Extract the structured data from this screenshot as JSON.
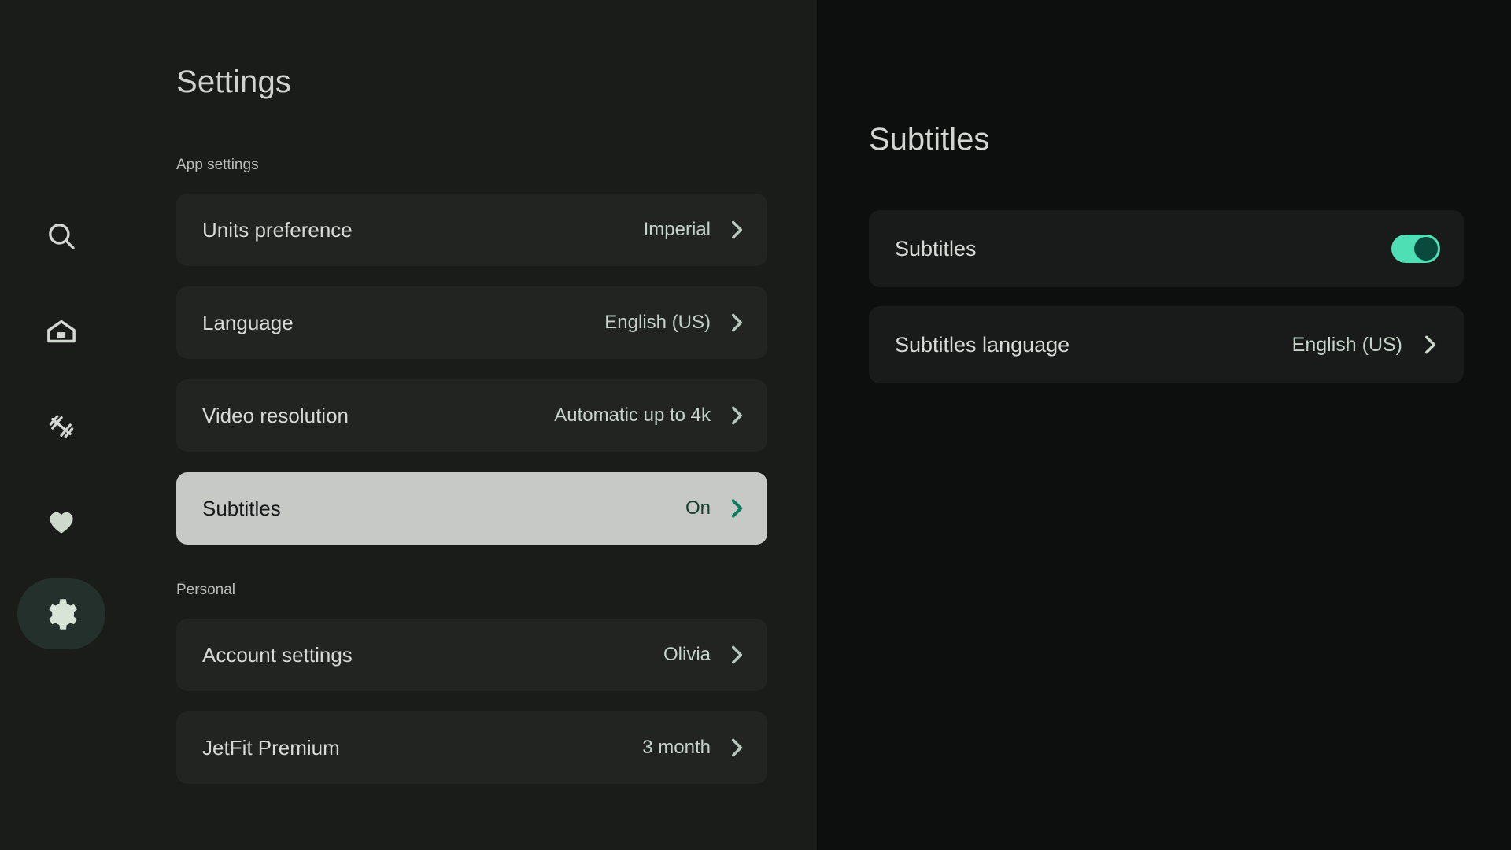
{
  "sidebar": {
    "items": [
      {
        "icon": "search-icon",
        "name": "search",
        "active": false
      },
      {
        "icon": "home-icon",
        "name": "home",
        "active": false
      },
      {
        "icon": "dumbbell-icon",
        "name": "workouts",
        "active": false
      },
      {
        "icon": "heart-icon",
        "name": "favorites",
        "active": false
      },
      {
        "icon": "gear-icon",
        "name": "settings",
        "active": true
      }
    ]
  },
  "left": {
    "title": "Settings",
    "sections": [
      {
        "label": "App settings",
        "rows": [
          {
            "label": "Units preference",
            "value": "Imperial",
            "selected": false
          },
          {
            "label": "Language",
            "value": "English (US)",
            "selected": false
          },
          {
            "label": "Video resolution",
            "value": "Automatic up to 4k",
            "selected": false
          },
          {
            "label": "Subtitles",
            "value": "On",
            "selected": true
          }
        ]
      },
      {
        "label": "Personal",
        "rows": [
          {
            "label": "Account settings",
            "value": "Olivia",
            "selected": false
          },
          {
            "label": "JetFit Premium",
            "value": "3 month",
            "selected": false
          }
        ]
      }
    ]
  },
  "right": {
    "title": "Subtitles",
    "rows": [
      {
        "label": "Subtitles",
        "control": "toggle",
        "value": "",
        "toggle_on": true
      },
      {
        "label": "Subtitles language",
        "control": "chevron",
        "value": "English (US)",
        "toggle_on": false
      }
    ]
  },
  "colors": {
    "left_panel_bg": "#1a1c1a",
    "right_panel_bg": "#0d0f0e",
    "row_bg": "#222422",
    "selected_row_bg": "#c6c9c5",
    "accent_green": "#0e7a5f",
    "toggle_track": "#4fdfb4",
    "toggle_knob": "#0a4a3d",
    "rail_active_bg": "#23302b",
    "value_text": "#c6d3ca",
    "label_text": "#d6d9d5"
  }
}
